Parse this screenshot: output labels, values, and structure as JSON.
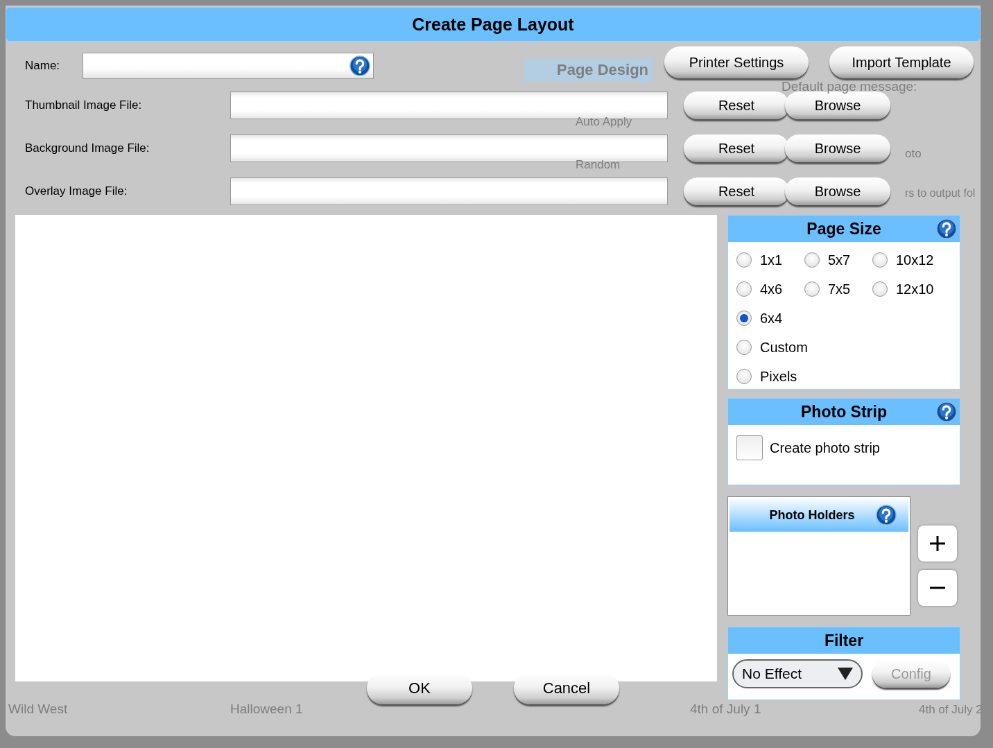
{
  "backdrop": {
    "texts": [
      "Page Design",
      "Default page message:",
      "Auto Apply",
      "Random",
      "oto",
      "rs to output fol",
      "Wild West",
      "Halloween 1",
      "4th of July 1",
      "4th of July 2"
    ]
  },
  "dialog": {
    "title": "Create Page Layout",
    "name": {
      "label": "Name:"
    },
    "top_buttons": [
      "Printer Settings",
      "Import Template"
    ],
    "file_rows": [
      {
        "label": "Thumbnail Image File:",
        "buttons": [
          "Reset",
          "Browse"
        ]
      },
      {
        "label": "Background Image File:",
        "buttons": [
          "Reset",
          "Browse"
        ]
      },
      {
        "label": "Overlay Image File:",
        "buttons": [
          "Reset",
          "Browse"
        ]
      }
    ],
    "page_size": {
      "title": "Page Size",
      "options": [
        {
          "label": "1x1",
          "selected": false
        },
        {
          "label": "5x7",
          "selected": false
        },
        {
          "label": "10x12",
          "selected": false
        },
        {
          "label": "4x6",
          "selected": false
        },
        {
          "label": "7x5",
          "selected": false
        },
        {
          "label": "12x10",
          "selected": false
        },
        {
          "label": "6x4",
          "selected": true
        },
        {
          "label": "Custom",
          "selected": false
        },
        {
          "label": "Pixels",
          "selected": false
        }
      ]
    },
    "photo_strip": {
      "title": "Photo Strip",
      "checkbox": {
        "label": "Create photo strip",
        "checked": false
      }
    },
    "photo_holders": {
      "title": "Photo Holders"
    },
    "filter": {
      "title": "Filter",
      "dropdown": {
        "value": "No Effect"
      },
      "config": {
        "label": "Config",
        "disabled": true
      }
    },
    "buttons": [
      "OK",
      "Cancel"
    ]
  }
}
